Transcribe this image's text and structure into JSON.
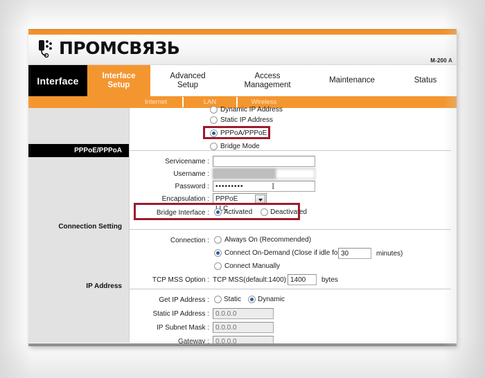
{
  "brand": {
    "name": "ПРОМСВЯЗЬ",
    "logo_icon": "phone-logo-icon",
    "model": "M-200 A"
  },
  "nav": {
    "section_title": "Interface",
    "tabs": [
      {
        "label": "Interface\nSetup",
        "line1": "Interface",
        "line2": "Setup",
        "active": true
      },
      {
        "label": "Advanced\nSetup",
        "line1": "Advanced",
        "line2": "Setup",
        "active": false
      },
      {
        "label": "Access\nManagement",
        "line1": "Access",
        "line2": "Management",
        "active": false
      },
      {
        "label": "Maintenance",
        "line1": "Maintenance",
        "line2": "",
        "active": false
      },
      {
        "label": "Status",
        "line1": "Status",
        "line2": "",
        "active": false
      }
    ],
    "subtabs": [
      {
        "label": "Internet",
        "active": true
      },
      {
        "label": "LAN",
        "active": false
      },
      {
        "label": "Wireless",
        "active": false
      }
    ]
  },
  "sections": {
    "isp_banner": "PPPoE/PPPoA",
    "connection_setting": "Connection Setting",
    "ip_address": "IP Address"
  },
  "isp": {
    "options": [
      {
        "label": "Dynamic IP Address",
        "selected": false
      },
      {
        "label": "Static IP Address",
        "selected": false
      },
      {
        "label": "PPPoA/PPPoE",
        "selected": true
      },
      {
        "label": "Bridge Mode",
        "selected": false
      }
    ]
  },
  "pppoe": {
    "servicename_label": "Servicename :",
    "servicename_value": "",
    "username_label": "Username :",
    "username_value": "user@example",
    "password_label": "Password :",
    "password_value": "•••••••••",
    "encapsulation_label": "Encapsulation :",
    "encapsulation_value": "PPPoE LLC",
    "encapsulation_arrow_icon": "chevron-down-icon",
    "bridge_interface_label": "Bridge Interface :",
    "bridge_options": [
      {
        "label": "Activated",
        "selected": true
      },
      {
        "label": "Deactivated",
        "selected": false
      }
    ]
  },
  "connection": {
    "label": "Connection :",
    "options": [
      {
        "label": "Always On (Recommended)",
        "selected": false
      },
      {
        "label": "Connect On-Demand (Close if idle for",
        "selected": true
      },
      {
        "label": "Connect Manually",
        "selected": false
      }
    ],
    "idle_value": "30",
    "idle_suffix": "minutes)",
    "tcp_mss_label": "TCP MSS Option :",
    "tcp_mss_text": "TCP MSS(default:1400)",
    "tcp_mss_value": "1400",
    "tcp_mss_unit": "bytes"
  },
  "ip": {
    "get_ip_label": "Get IP Address :",
    "get_ip_options": [
      {
        "label": "Static",
        "selected": false
      },
      {
        "label": "Dynamic",
        "selected": true
      }
    ],
    "static_ip_label": "Static IP Address :",
    "static_ip_value": "0.0.0.0",
    "subnet_label": "IP Subnet Mask :",
    "subnet_value": "0.0.0.0",
    "gateway_label": "Gateway :",
    "gateway_value": "0.0.0.0"
  },
  "highlights": {
    "pppoa_box": "highlight-pppoa-option",
    "bridge_box": "highlight-bridge-interface"
  },
  "colors": {
    "orange": "#F4962F",
    "black": "#000000",
    "highlight_red": "#9B1B2E",
    "sidebar_grey": "#e2e2e2"
  }
}
